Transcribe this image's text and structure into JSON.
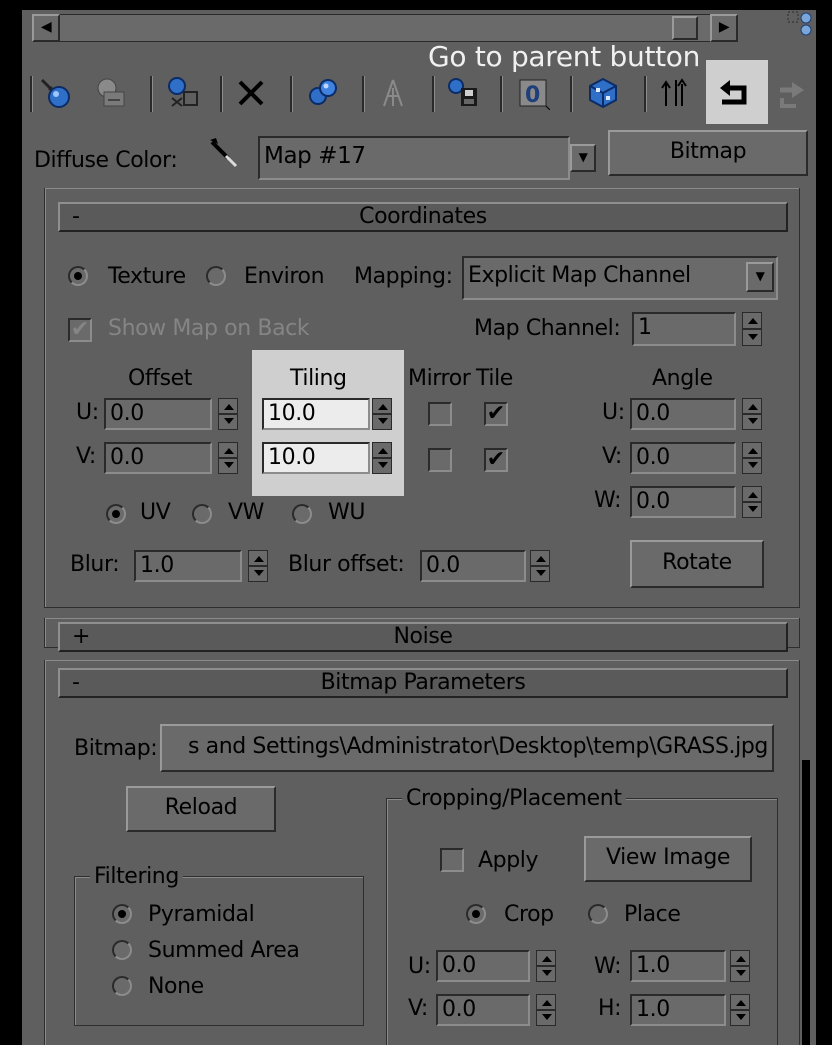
{
  "annotation": {
    "text": "Go to parent button"
  },
  "toolbar": {
    "icons": [
      "get-material-icon",
      "put-to-scene-icon",
      "assign-material-icon",
      "reset-map-icon",
      "make-unique-icon",
      "put-to-library-icon",
      "material-id-channel-icon",
      "show-map-in-viewport-icon",
      "show-end-result-icon",
      "go-to-parent-icon",
      "go-forward-to-sibling-icon"
    ]
  },
  "diffuse": {
    "label": "Diffuse Color:",
    "map_name": "Map #17",
    "type_button": "Bitmap"
  },
  "coordinates": {
    "sign": "-",
    "title": "Coordinates",
    "texture_label": "Texture",
    "environ_label": "Environ",
    "mapping_label": "Mapping:",
    "mapping_value": "Explicit Map Channel",
    "show_map_on_back": "Show Map on Back",
    "map_channel_label": "Map Channel:",
    "map_channel_value": "1",
    "offset_label": "Offset",
    "tiling_label": "Tiling",
    "mirror_label": "Mirror",
    "tile_label": "Tile",
    "angle_label": "Angle",
    "u_label": "U:",
    "v_label": "V:",
    "w_label": "W:",
    "offset_u": "0.0",
    "offset_v": "0.0",
    "tiling_u": "10.0",
    "tiling_v": "10.0",
    "tile_check": "✔",
    "angle_u": "0.0",
    "angle_v": "0.0",
    "angle_w": "0.0",
    "uv_label": "UV",
    "vw_label": "VW",
    "wu_label": "WU",
    "blur_label": "Blur:",
    "blur_value": "1.0",
    "blur_offset_label": "Blur offset:",
    "blur_offset_value": "0.0",
    "rotate_button": "Rotate"
  },
  "noise": {
    "sign": "+",
    "title": "Noise"
  },
  "bitmap_params": {
    "sign": "-",
    "title": "Bitmap Parameters",
    "bitmap_label": "Bitmap:",
    "bitmap_path": "s and Settings\\Administrator\\Desktop\\temp\\GRASS.jpg",
    "reload_button": "Reload",
    "filtering_label": "Filtering",
    "pyramidal": "Pyramidal",
    "summed_area": "Summed Area",
    "none": "None",
    "cropping_label": "Cropping/Placement",
    "apply_label": "Apply",
    "view_image_button": "View Image",
    "crop_label": "Crop",
    "place_label": "Place",
    "u_label": "U:",
    "v_label": "V:",
    "w_label": "W:",
    "h_label": "H:",
    "crop_u": "0.0",
    "crop_v": "0.0",
    "crop_w": "1.0",
    "crop_h": "1.0"
  }
}
